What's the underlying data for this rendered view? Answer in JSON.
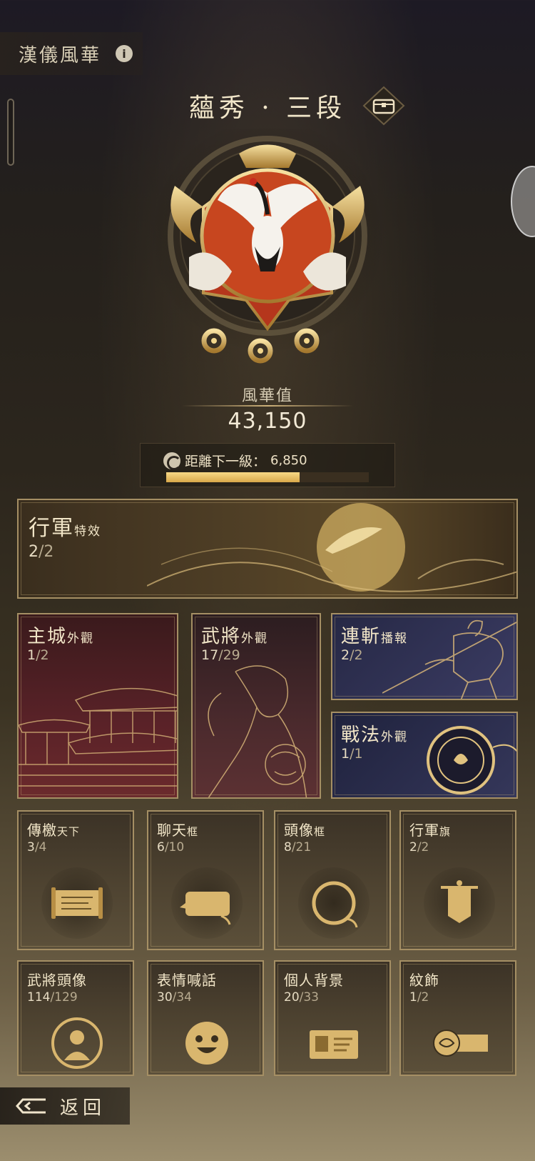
{
  "header": {
    "title": "漢儀風華",
    "info_icon": "info-icon"
  },
  "rank": {
    "title": "蘊秀 · 三段",
    "chest_icon": "chest-icon"
  },
  "prestige": {
    "label": "風華值",
    "value": "43,150"
  },
  "progress": {
    "label": "距離下一級：",
    "value": "6,850",
    "fraction": 0.657
  },
  "cards": {
    "march_effect": {
      "name_big": "行軍",
      "name_small": "特效",
      "current": "2",
      "total": "/2"
    },
    "city_look": {
      "name_big": "主城",
      "name_small": "外觀",
      "current": "1",
      "total": "/2"
    },
    "general_look": {
      "name_big": "武將",
      "name_small": "外觀",
      "current": "17",
      "total": "/29"
    },
    "combo_broadcast": {
      "name_big": "連斬",
      "name_small": "播報",
      "current": "2",
      "total": "/2"
    },
    "tactic_look": {
      "name_big": "戰法",
      "name_small": "外觀",
      "current": "1",
      "total": "/1"
    },
    "decree": {
      "name_big": "傳檄",
      "name_small": "天下",
      "current": "3",
      "total": "/4"
    },
    "chat_frame": {
      "name_big": "聊天",
      "name_small": "框",
      "current": "6",
      "total": "/10"
    },
    "avatar_frame": {
      "name_big": "頭像",
      "name_small": "框",
      "current": "8",
      "total": "/21"
    },
    "march_flag": {
      "name_big": "行軍",
      "name_small": "旗",
      "current": "2",
      "total": "/2"
    },
    "general_avatar": {
      "name_big": "武將頭像",
      "name_small": "",
      "current": "114",
      "total": "/129"
    },
    "emote": {
      "name_big": "表情喊話",
      "name_small": "",
      "current": "30",
      "total": "/34"
    },
    "background": {
      "name_big": "個人背景",
      "name_small": "",
      "current": "20",
      "total": "/33"
    },
    "ornament": {
      "name_big": "紋飾",
      "name_small": "",
      "current": "1",
      "total": "/2"
    }
  },
  "footer": {
    "back_label": "返回"
  },
  "colors": {
    "gold": "#d8b267",
    "progress": "#f1cf7c",
    "crimson": "#b5361c"
  }
}
